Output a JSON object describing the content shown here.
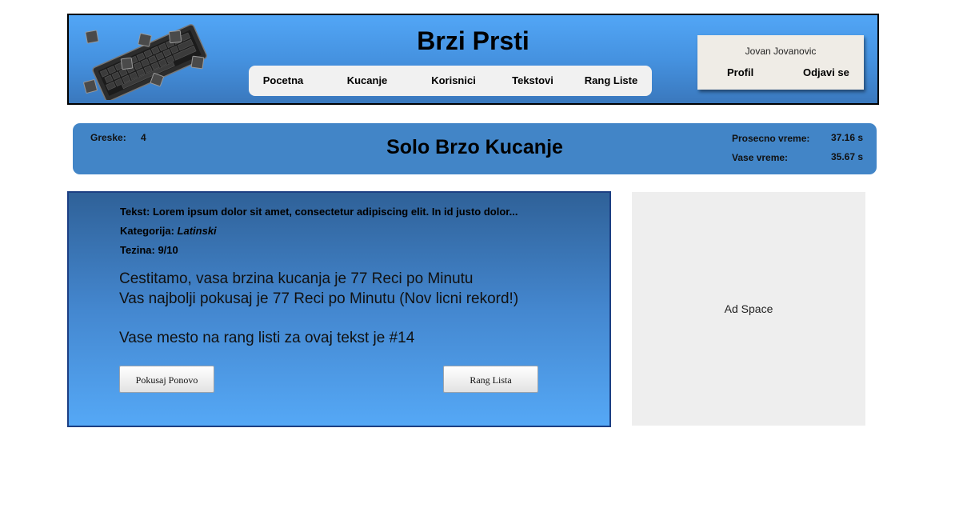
{
  "header": {
    "site_title": "Brzi Prsti",
    "logo_icon": "keyboard-icon",
    "nav": [
      {
        "label": "Pocetna"
      },
      {
        "label": "Kucanje"
      },
      {
        "label": "Korisnici"
      },
      {
        "label": "Tekstovi"
      },
      {
        "label": "Rang Liste"
      }
    ],
    "user": {
      "name": "Jovan Jovanovic",
      "profile_label": "Profil",
      "logout_label": "Odjavi se"
    }
  },
  "stats": {
    "errors_label": "Greske:",
    "errors_value": "4",
    "mode_title": "Solo Brzo Kucanje",
    "avg_time_label": "Prosecno vreme:",
    "avg_time_value": "37.16 s",
    "your_time_label": "Vase vreme:",
    "your_time_value": "35.67 s"
  },
  "result": {
    "text_label": "Tekst:",
    "text_value": "Lorem ipsum dolor sit amet, consectetur adipiscing elit. In id justo dolor...",
    "category_label": "Kategorija:",
    "category_value": "Latinski",
    "difficulty_label": "Tezina:",
    "difficulty_value": "9/10",
    "speed_message": "Cestitamo, vasa brzina kucanja je 77 Reci po Minutu",
    "best_message": "Vas najbolji pokusaj je 77 Reci po Minutu (Nov licni rekord!)",
    "rank_message": "Vase mesto na rang listi za ovaj tekst je #14",
    "retry_button": "Pokusaj Ponovo",
    "leaderboard_button": "Rang Lista"
  },
  "ad": {
    "label": "Ad Space"
  },
  "colors": {
    "header_gradient_top": "#52a6f6",
    "header_gradient_bottom": "#3a78bd",
    "stats_bar": "#4285c7",
    "panel_border": "#1c3f83",
    "ad_background": "#eeeeee"
  }
}
